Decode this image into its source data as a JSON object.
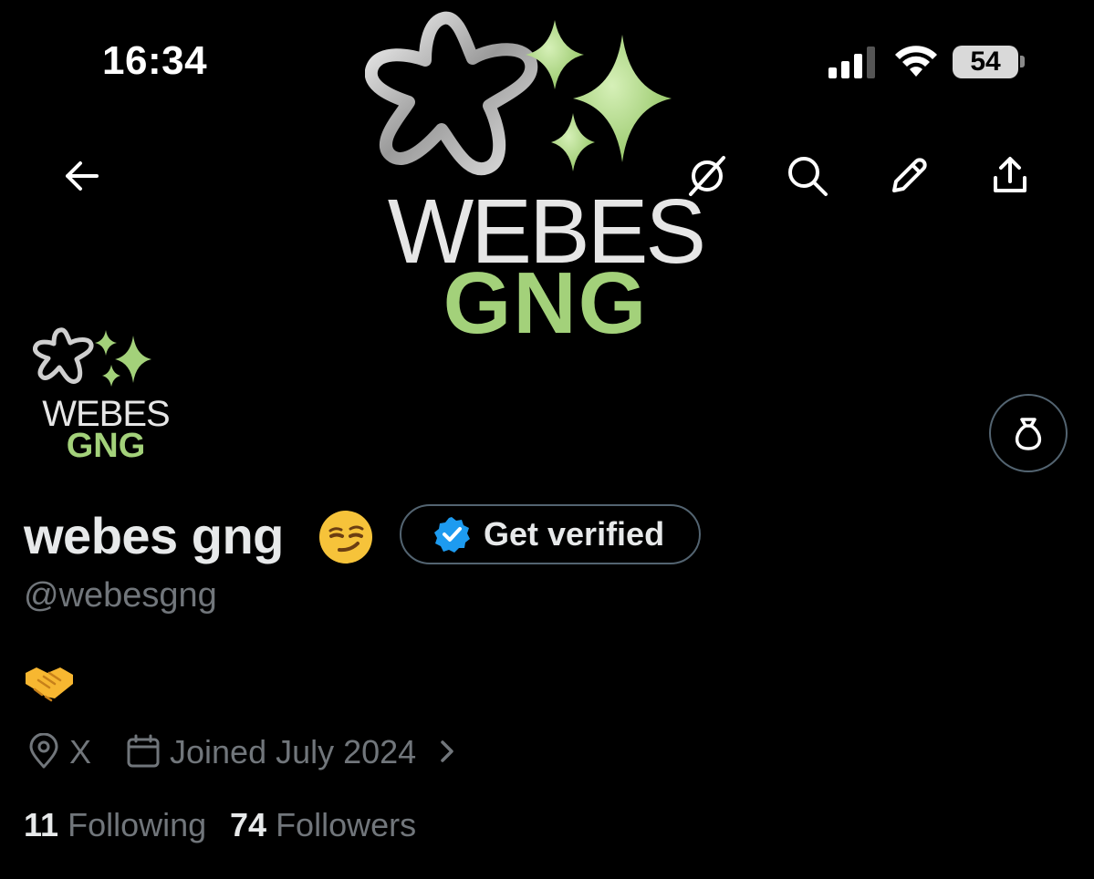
{
  "status_bar": {
    "time": "16:34",
    "battery": "54"
  },
  "banner": {
    "line1": "WEBES",
    "line2": "GNG",
    "accent_color": "#a3d17a"
  },
  "nav": {
    "icons": [
      "back-arrow-icon",
      "grok-icon",
      "search-icon",
      "edit-pencil-icon",
      "share-icon"
    ]
  },
  "avatar": {
    "line1": "WEBES",
    "line2": "GNG"
  },
  "profile": {
    "display_name": "webes gng",
    "name_emoji": "smirking-face-emoji",
    "get_verified_label": "Get verified",
    "handle": "@webesgng",
    "bio_emoji": "handshake-emoji",
    "location": "X",
    "joined": "Joined July 2024",
    "following_count": "11",
    "following_label": "Following",
    "followers_count": "74",
    "followers_label": "Followers"
  },
  "colors": {
    "verified_blue": "#1d9bf0",
    "muted_text": "#71767b",
    "border": "#536471"
  }
}
